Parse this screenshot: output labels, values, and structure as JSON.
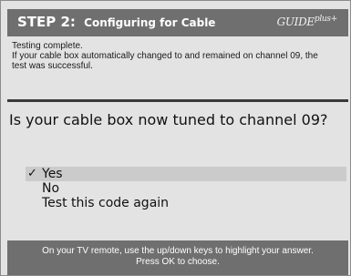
{
  "header": {
    "step": "STEP 2:",
    "title": "Configuring for Cable",
    "logo": "GUIDE",
    "logo_plus": "plus+"
  },
  "info": {
    "line1": "Testing complete.",
    "line2": "If your cable box automatically changed to and remained on channel 09, the",
    "line3": "test was successful."
  },
  "question": "Is your cable box now tuned to channel 09?",
  "options": [
    {
      "label": "Yes",
      "selected": true,
      "check": "✓"
    },
    {
      "label": "No",
      "selected": false
    },
    {
      "label": "Test this code again",
      "selected": false
    }
  ],
  "footer": {
    "line1": "On your TV remote, use the up/down keys to highlight your answer.",
    "line2": "Press OK to choose."
  },
  "colors": {
    "bar": "#6f6f6f",
    "panel": "#e3e3e3",
    "highlight": "#cbcbcb",
    "divider": "#3a3a3a"
  }
}
